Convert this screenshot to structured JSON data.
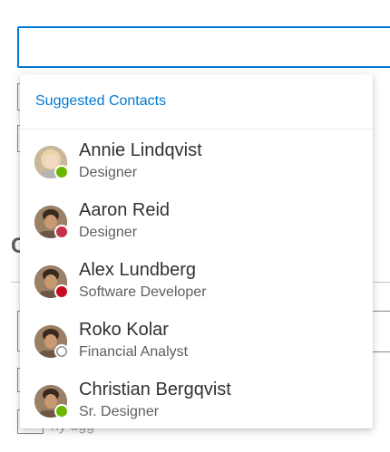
{
  "picker": {
    "value": "",
    "suggestions_header": "Suggested Contacts",
    "contacts": [
      {
        "name": "Annie Lindqvist",
        "role": "Designer",
        "presence": "available",
        "avatar": "woman-blonde"
      },
      {
        "name": "Aaron Reid",
        "role": "Designer",
        "presence": "busy",
        "avatar": "man-dark-hair"
      },
      {
        "name": "Alex Lundberg",
        "role": "Software Developer",
        "presence": "do-not-disturb",
        "avatar": "man-dark-hair"
      },
      {
        "name": "Roko Kolar",
        "role": "Financial Analyst",
        "presence": "offline",
        "avatar": "man-dark-hair"
      },
      {
        "name": "Christian Bergqvist",
        "role": "Sr. Designer",
        "presence": "available",
        "avatar": "man-dark-hair"
      }
    ]
  },
  "colors": {
    "accent": "#0078d4",
    "available": "#6bb700",
    "busy": "#c4314b",
    "do_not_disturb": "#c50f1f",
    "offline": "#8a8886"
  }
}
